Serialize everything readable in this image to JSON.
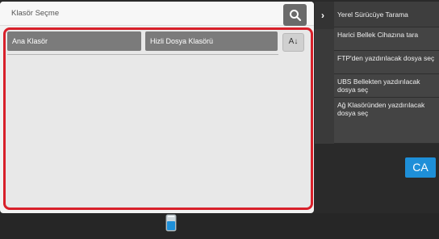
{
  "title": "Klasör Seçme",
  "tabs": [
    "Ana Klasör",
    "Hizli Dosya Klasörü"
  ],
  "sort_button": "A↓",
  "side_menu": [
    "Yerel Sürücüye Tarama",
    "Harici Bellek Cihazına tara",
    "FTP'den yazdırılacak dosya seç",
    "UBS Bellekten yazdırılacak dosya seç",
    "Ağ Klasöründen yazdırılacak dosya seç"
  ],
  "ca_button": "CA",
  "icons": {
    "search": "search-icon",
    "sort": "sort-icon",
    "expand": "chevron-right-icon",
    "toner": "toner-icon"
  },
  "colors": {
    "highlight": "#d8202a",
    "ca": "#1e8fd8",
    "tab": "#7b7b7b"
  }
}
